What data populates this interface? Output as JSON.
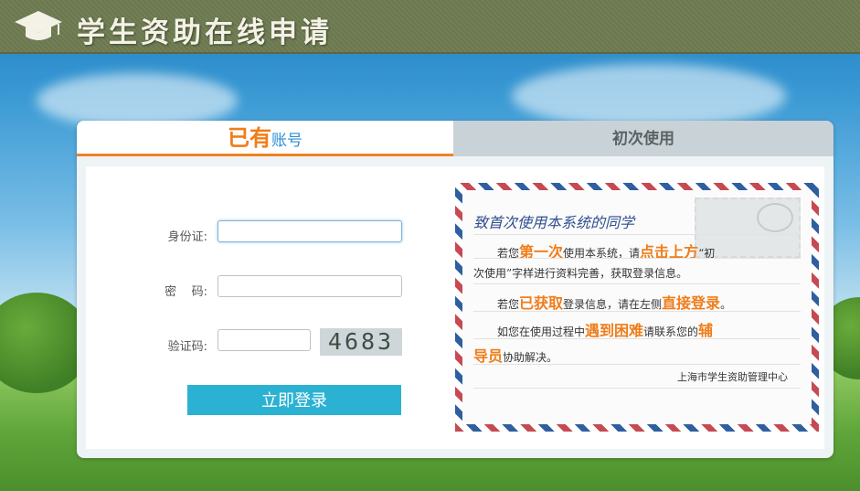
{
  "header": {
    "title": "学生资助在线申请",
    "logo_icon": "graduation-cap-icon"
  },
  "tabs": {
    "active": {
      "big": "已有",
      "small": "账号"
    },
    "inactive": "初次使用"
  },
  "login_form": {
    "id_label": "身份证:",
    "id_value": "",
    "password_label": "密    码:",
    "password_value": "",
    "captcha_label": "验证码:",
    "captcha_value": "",
    "captcha_text": "4683",
    "submit_label": "立即登录"
  },
  "notice": {
    "heading": "致首次使用本系统的同学",
    "p1_a": "若您",
    "p1_hl1": "第一次",
    "p1_b": "使用本系统，请",
    "p1_hl2": "点击上方",
    "p1_c": "“初",
    "p1_line2": "次使用”字样进行资料完善，获取登录信息。",
    "p2_a": "若您",
    "p2_hl1": "已获取",
    "p2_b": "登录信息，请在左侧",
    "p2_hl2": "直接登录",
    "p2_c": "。",
    "p3_a": "如您在使用过程中",
    "p3_hl1": "遇到困难",
    "p3_b": "请联系您的",
    "p3_hl2": "辅",
    "p3_hl3": "导员",
    "p3_c": "协助解决。",
    "signature": "上海市学生资助管理中心"
  },
  "colors": {
    "accent_orange": "#f07d1a",
    "tab_blue": "#2b8fd5",
    "button_cyan": "#2bb2d3",
    "header_olive": "#727f57"
  }
}
